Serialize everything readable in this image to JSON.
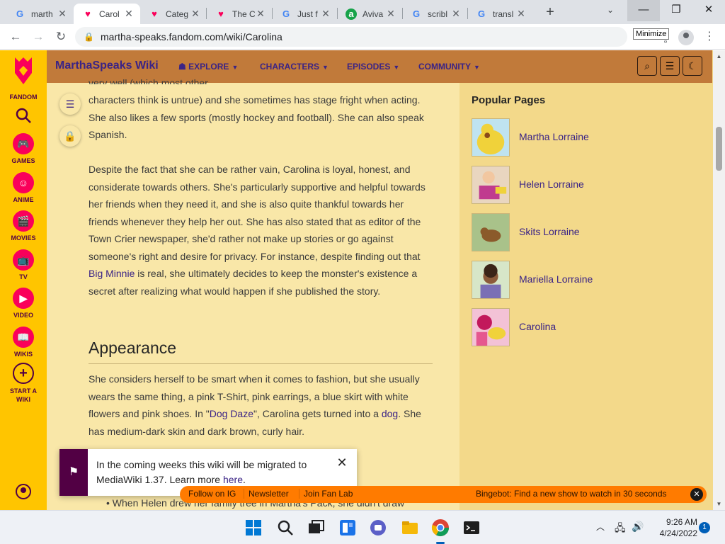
{
  "browser": {
    "tabs": [
      {
        "title": "marth",
        "favicon": "google-icon"
      },
      {
        "title": "Carol",
        "favicon": "fandom-icon",
        "active": true
      },
      {
        "title": "Categ",
        "favicon": "fandom-icon"
      },
      {
        "title": "The C",
        "favicon": "fandom-icon"
      },
      {
        "title": "Just f",
        "favicon": "google-icon"
      },
      {
        "title": "Aviva",
        "favicon": "aviva-icon"
      },
      {
        "title": "scribl",
        "favicon": "google-icon"
      },
      {
        "title": "transl",
        "favicon": "google-icon"
      }
    ],
    "url": "martha-speaks.fandom.com/wiki/Carolina",
    "tooltip": "Minimize"
  },
  "rail": {
    "brand": "FANDOM",
    "items": [
      "GAMES",
      "ANIME",
      "MOVIES",
      "TV",
      "VIDEO",
      "WIKIS",
      "START A WIKI"
    ]
  },
  "wiki": {
    "name": "MarthaSpeaks Wiki",
    "nav": [
      "EXPLORE",
      "CHARACTERS",
      "EPISODES",
      "COMMUNITY"
    ]
  },
  "article": {
    "partial_top": "very well (which most other",
    "para1": "characters think is untrue) and she sometimes has stage fright when acting. She also likes a few sports (mostly hockey and football). She can also speak Spanish.",
    "para2_before": "Despite the fact that she can be rather vain, Carolina is loyal, honest, and considerate towards others. She's particularly supportive and helpful towards her friends when they need it, and she is also quite thankful towards her friends whenever they help her out. She has also stated that as editor of the Town Crier newspaper, she'd rather not make up stories or go against someone's right and desire for privacy. For instance, despite finding out that ",
    "para2_link": "Big Minnie",
    "para2_after": " is real, she ultimately decides to keep the monster's existence a secret after realizing what would happen if she published the story.",
    "appearance_heading": "Appearance",
    "para3_a": "She considers herself to be smart when it comes to fashion, but she usually wears the same thing, a pink T-Shirt, pink earrings, a blue skirt with white flowers and pink shoes. In \"",
    "para3_link1": "Dog Daze",
    "para3_b": "\", Carolina gets turned into a ",
    "para3_link2": "dog",
    "para3_c": ". She has medium-dark skin and dark brown, curly hair.",
    "bottom_bullet": "When Helen drew her family tree in Martha's Pack, she didn't draw"
  },
  "popular": {
    "title": "Popular Pages",
    "items": [
      "Martha Lorraine",
      "Helen Lorraine",
      "Skits Lorraine",
      "Mariella Lorraine",
      "Carolina"
    ]
  },
  "notice": {
    "text_before": "In the coming weeks this wiki will be migrated to MediaWiki 1.37. Learn more ",
    "link": "here",
    "text_after": "."
  },
  "promo": {
    "buttons": [
      "Follow on IG",
      "Newsletter",
      "Join Fan Lab"
    ],
    "bingebot": "Bingebot: Find a new show to watch in 30 seconds"
  },
  "taskbar": {
    "time": "9:26 AM",
    "date": "4/24/2022",
    "notifications": "1"
  },
  "colors": {
    "fandom_yellow": "#ffc500",
    "header_brown": "#c17a3a",
    "link_purple": "#3a2386",
    "promo_orange": "#ff7b00"
  }
}
